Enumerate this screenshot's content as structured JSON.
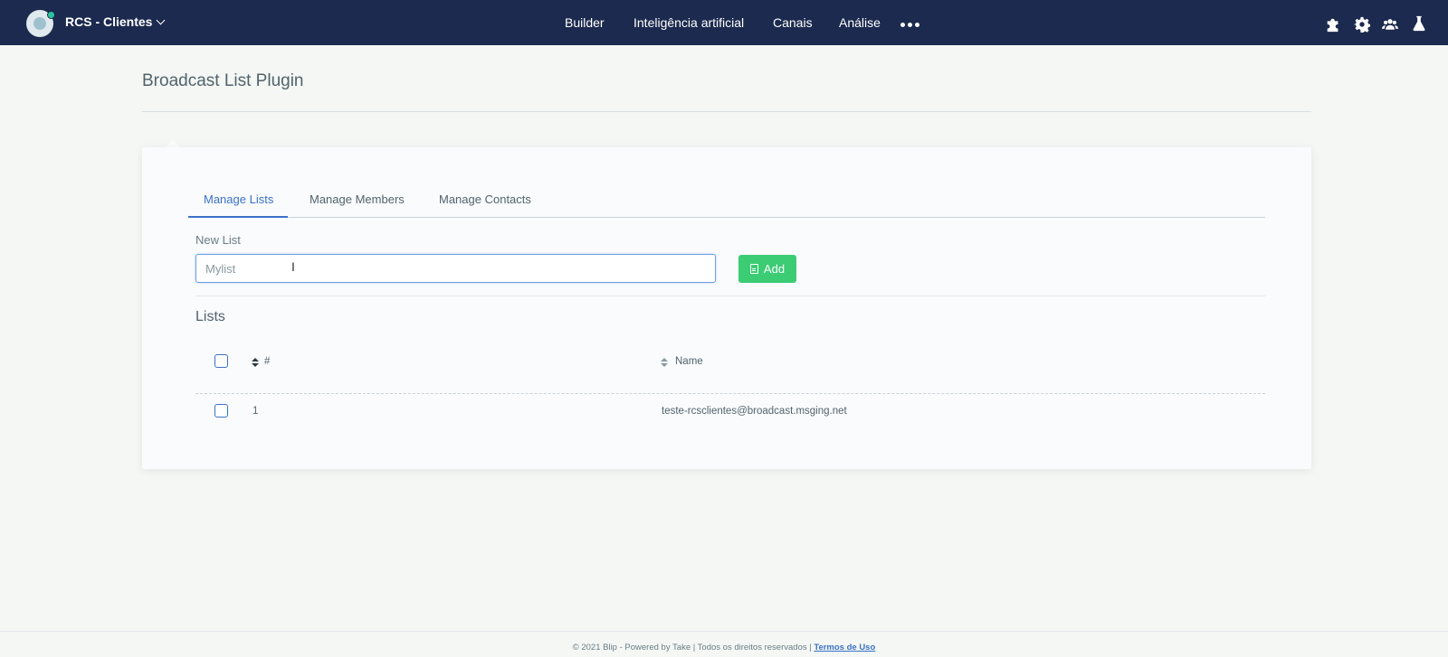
{
  "header": {
    "bot_name": "RCS - Clientes",
    "nav": [
      "Builder",
      "Inteligência artificial",
      "Canais",
      "Análise"
    ],
    "icons": [
      "puzzle-icon",
      "gear-icon",
      "users-icon",
      "flask-icon"
    ],
    "colors": {
      "bar": "#1b2a4e",
      "status_dot": "#2cc3a0"
    }
  },
  "page": {
    "title": "Broadcast List Plugin"
  },
  "tabs": {
    "manage_lists": "Manage Lists",
    "manage_members": "Manage Members",
    "manage_contacts": "Manage Contacts",
    "active": "Manage Lists"
  },
  "form": {
    "new_list_label": "New List",
    "new_list_placeholder": "Mylist",
    "new_list_value": "",
    "add_label": "Add"
  },
  "lists": {
    "title": "Lists",
    "columns": {
      "id": "#",
      "name": "Name"
    },
    "rows": [
      {
        "id": "1",
        "name": "teste-rcsclientes@broadcast.msging.net"
      }
    ]
  },
  "footer": {
    "text": "© 2021 Blip - Powered by Take | Todos os direitos reservados | ",
    "link": "Termos de Uso"
  },
  "colors": {
    "accent": "#3b71c6",
    "add_button": "#3ccc74"
  }
}
